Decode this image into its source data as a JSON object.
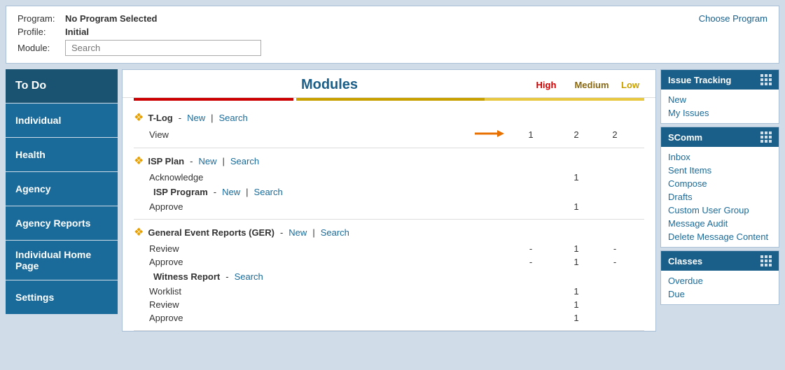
{
  "topbar": {
    "program_label": "Program:",
    "program_value": "No Program Selected",
    "profile_label": "Profile:",
    "profile_value": "Initial",
    "module_label": "Module:",
    "search_placeholder": "Search",
    "choose_program": "Choose Program"
  },
  "sidebar": {
    "items": [
      {
        "id": "todo",
        "label": "To Do"
      },
      {
        "id": "individual",
        "label": "Individual"
      },
      {
        "id": "health",
        "label": "Health"
      },
      {
        "id": "agency",
        "label": "Agency"
      },
      {
        "id": "agency-reports",
        "label": "Agency Reports"
      },
      {
        "id": "individual-home-page",
        "label": "Individual Home Page"
      },
      {
        "id": "settings",
        "label": "Settings"
      }
    ]
  },
  "modules": {
    "title": "Modules",
    "priority_high": "High",
    "priority_medium": "Medium",
    "priority_low": "Low",
    "sections": [
      {
        "id": "tlog",
        "icon": "❖",
        "name": "T-Log",
        "links": [
          "New",
          "Search"
        ],
        "rows": [
          {
            "label": "View",
            "has_arrow": true,
            "high": "1",
            "medium": "2",
            "low": "2"
          }
        ]
      },
      {
        "id": "isp",
        "icon": "❖",
        "name": "ISP Plan",
        "links": [
          "New",
          "Search"
        ],
        "rows": [
          {
            "label": "Acknowledge",
            "has_arrow": false,
            "high": "",
            "medium": "1",
            "low": ""
          }
        ],
        "sub": [
          {
            "name": "ISP Program",
            "links": [
              "New",
              "Search"
            ],
            "rows": [
              {
                "label": "Approve",
                "has_arrow": false,
                "high": "",
                "medium": "1",
                "low": ""
              }
            ]
          }
        ]
      },
      {
        "id": "ger",
        "icon": "❖",
        "name": "General Event Reports (GER)",
        "links": [
          "New",
          "Search"
        ],
        "rows": [
          {
            "label": "Review",
            "has_arrow": false,
            "high": "-",
            "medium": "1",
            "low": "-"
          },
          {
            "label": "Approve",
            "has_arrow": false,
            "high": "-",
            "medium": "1",
            "low": "-"
          }
        ],
        "sub": [
          {
            "name": "Witness Report",
            "links": [
              "Search"
            ],
            "rows": [
              {
                "label": "Worklist",
                "has_arrow": false,
                "high": "",
                "medium": "1",
                "low": ""
              },
              {
                "label": "Review",
                "has_arrow": false,
                "high": "",
                "medium": "1",
                "low": ""
              },
              {
                "label": "Approve",
                "has_arrow": false,
                "high": "",
                "medium": "1",
                "low": ""
              }
            ]
          }
        ]
      }
    ]
  },
  "right_panels": [
    {
      "id": "issue-tracking",
      "title": "Issue Tracking",
      "links": [
        "New",
        "My Issues"
      ]
    },
    {
      "id": "scomm",
      "title": "SComm",
      "links": [
        "Inbox",
        "Sent Items",
        "Compose",
        "Drafts",
        "Custom User Group",
        "Message Audit",
        "Delete Message Content"
      ]
    },
    {
      "id": "classes",
      "title": "Classes",
      "links": [
        "Overdue",
        "Due"
      ]
    }
  ]
}
